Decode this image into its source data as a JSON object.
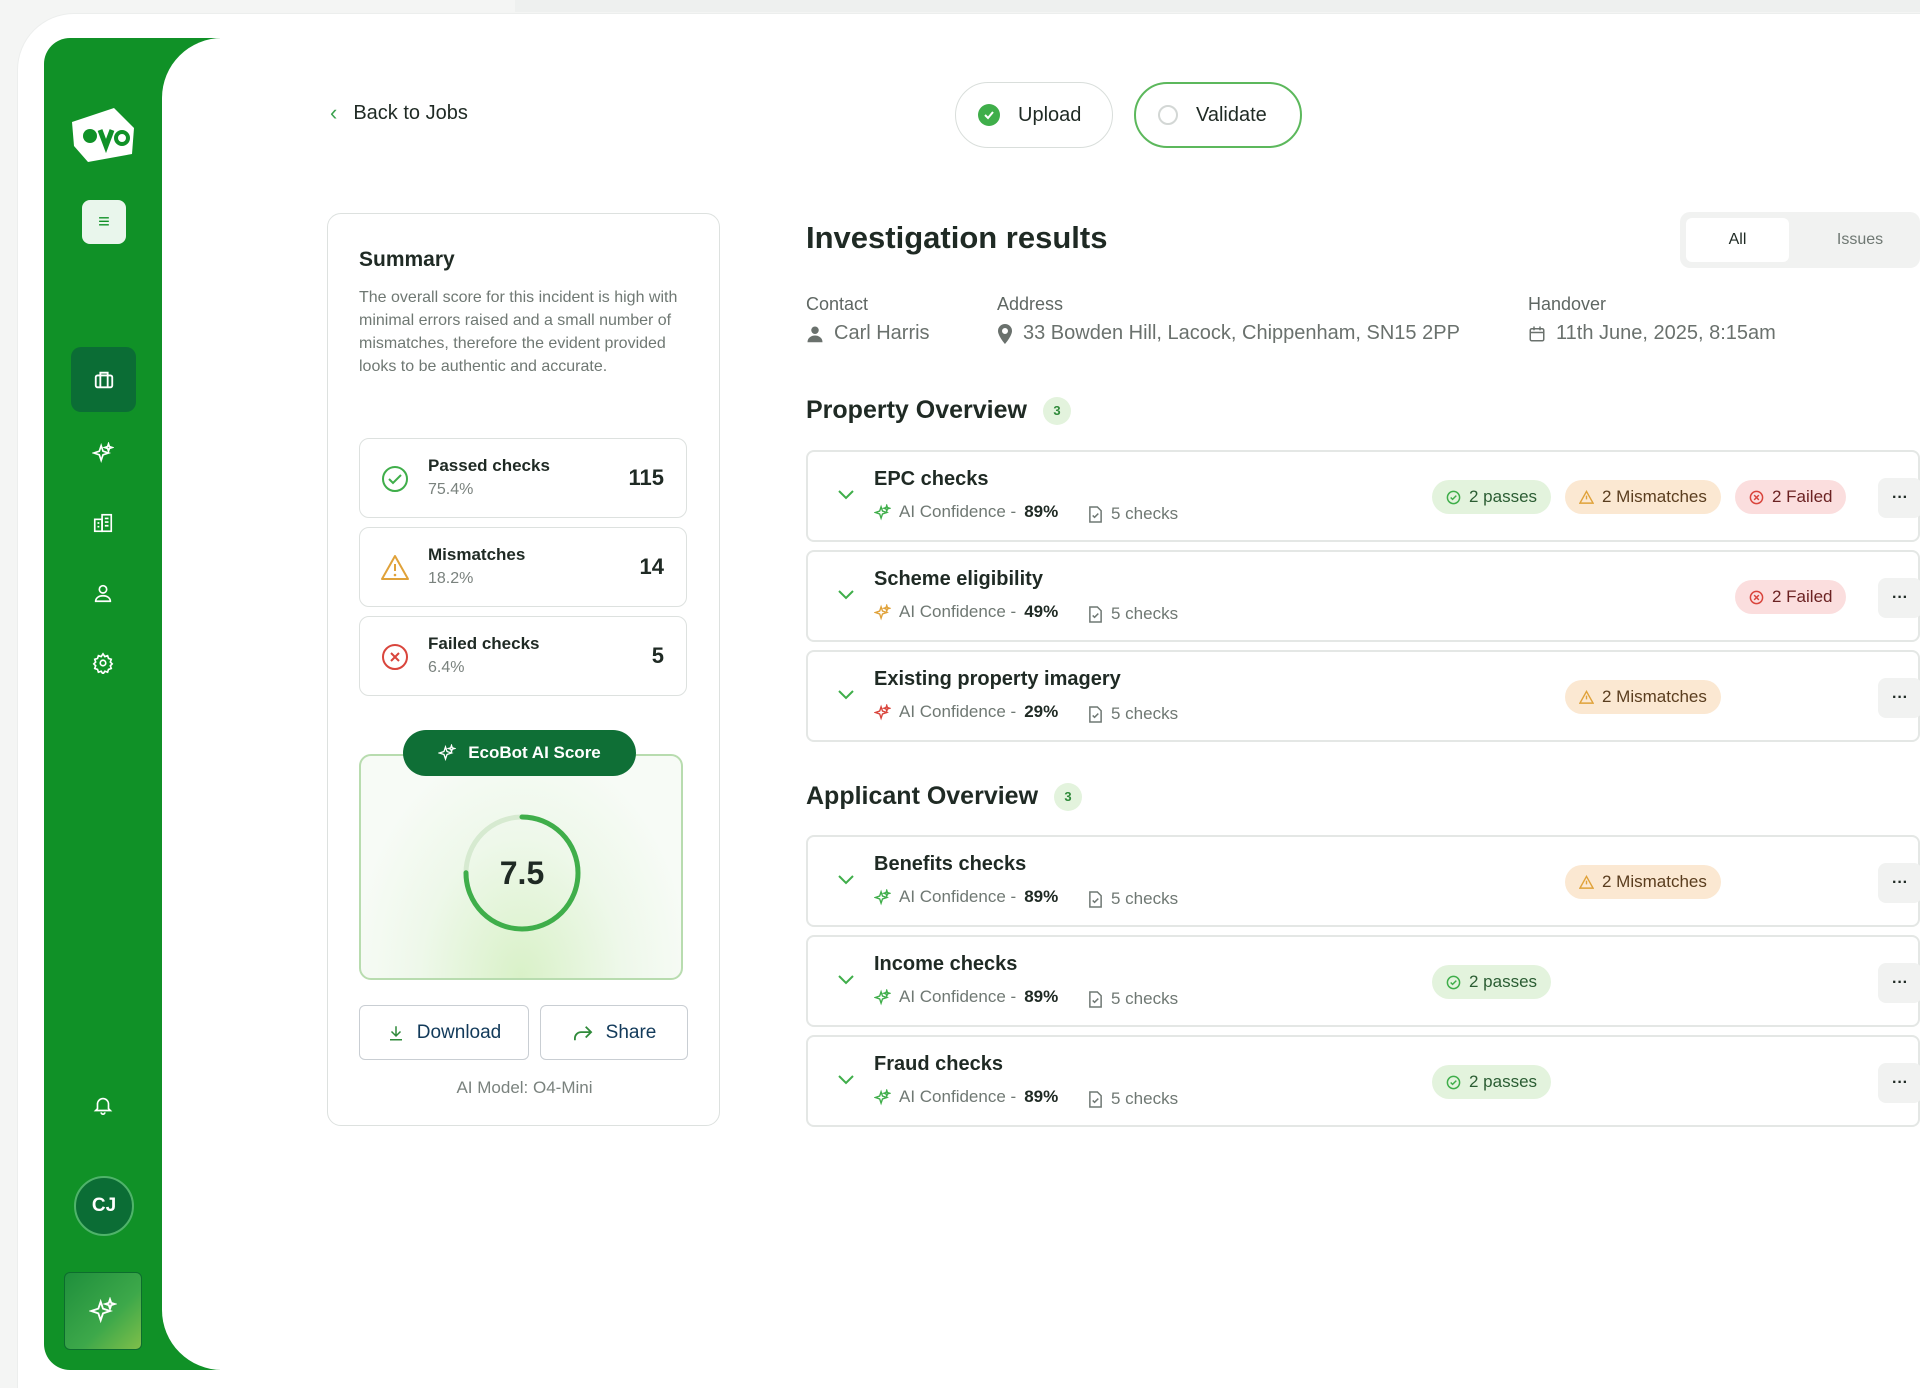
{
  "colors": {
    "brand": "#109127",
    "brand_dark": "#0b6d35",
    "pass": "#3fae4a",
    "mismatch": "#e0a23a",
    "fail": "#d9453c"
  },
  "sidebar": {
    "menu_icon": "menu-icon",
    "items": [
      {
        "name": "jobs",
        "icon": "briefcase-icon",
        "active": true
      },
      {
        "name": "ai",
        "icon": "sparkles-icon"
      },
      {
        "name": "properties",
        "icon": "buildings-icon"
      },
      {
        "name": "users",
        "icon": "user-icon"
      },
      {
        "name": "settings",
        "icon": "gear-icon"
      }
    ],
    "bell_icon": "bell-icon",
    "avatar_initials": "CJ",
    "ai_launcher_icon": "sparkles-icon"
  },
  "header": {
    "back_label": "Back to Jobs",
    "steps": [
      {
        "label": "Upload",
        "status": "complete"
      },
      {
        "label": "Validate",
        "status": "current"
      }
    ]
  },
  "summary": {
    "title": "Summary",
    "description": "The overall score for this incident is high with minimal errors raised and a small number of mismatches, therefore the evident provided looks to be authentic and accurate.",
    "stats": [
      {
        "label": "Passed checks",
        "percent": "75.4%",
        "value": "115",
        "icon": "check-circle-icon"
      },
      {
        "label": "Mismatches",
        "percent": "18.2%",
        "value": "14",
        "icon": "warning-icon"
      },
      {
        "label": "Failed checks",
        "percent": "6.4%",
        "value": "5",
        "icon": "x-circle-icon"
      }
    ],
    "score_label": "EcoBot AI Score",
    "score_value": "7.5",
    "score_fraction": 0.75,
    "download_label": "Download",
    "share_label": "Share",
    "model_label": "AI Model: O4-Mini"
  },
  "results": {
    "title": "Investigation results",
    "filters": {
      "all": "All",
      "issues": "Issues",
      "selected": "All"
    },
    "contact_label": "Contact",
    "contact_value": "Carl Harris",
    "address_label": "Address",
    "address_value": "33 Bowden Hill, Lacock, Chippenham, SN15 2PP",
    "handover_label": "Handover",
    "handover_value": "11th June, 2025, 8:15am"
  },
  "property_overview": {
    "title": "Property Overview",
    "count": "3",
    "rows": [
      {
        "title": "EPC checks",
        "confidence_label": "AI Confidence -",
        "confidence": "89%",
        "checks": "5 checks",
        "passes": "2 passes",
        "mismatches": "2 Mismatches",
        "failed": "2 Failed"
      },
      {
        "title": "Scheme eligibility",
        "confidence_label": "AI Confidence -",
        "confidence": "49%",
        "checks": "5 checks",
        "failed": "2 Failed"
      },
      {
        "title": "Existing property imagery",
        "confidence_label": "AI Confidence -",
        "confidence": "29%",
        "checks": "5 checks",
        "mismatches": "2 Mismatches"
      }
    ]
  },
  "applicant_overview": {
    "title": "Applicant Overview",
    "count": "3",
    "rows": [
      {
        "title": "Benefits checks",
        "confidence_label": "AI Confidence -",
        "confidence": "89%",
        "checks": "5 checks",
        "mismatches": "2 Mismatches"
      },
      {
        "title": "Income checks",
        "confidence_label": "AI Confidence -",
        "confidence": "89%",
        "checks": "5 checks",
        "passes": "2 passes"
      },
      {
        "title": "Fraud checks",
        "confidence_label": "AI Confidence -",
        "confidence": "89%",
        "checks": "5 checks",
        "passes": "2 passes"
      }
    ]
  },
  "more_label": "···"
}
